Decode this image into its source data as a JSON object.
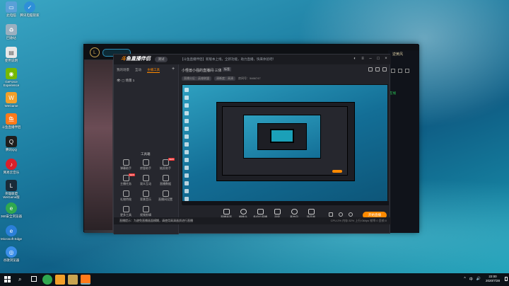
{
  "desktop": {
    "icons": [
      {
        "label": "此电脑",
        "icon": "computer-icon",
        "color": "#5aa0d8"
      },
      {
        "label": "腾讯电脑管家",
        "icon": "tencent-manager-icon",
        "color": "#2e8fd8"
      },
      {
        "label": "回收站",
        "icon": "recycle-bin-icon",
        "color": "#9ab0c0"
      },
      {
        "label": "使用说明",
        "icon": "document-icon",
        "color": "#e8e8e8"
      },
      {
        "label": "GeForce Experience",
        "icon": "geforce-icon",
        "color": "#76b900"
      },
      {
        "label": "WeGame",
        "icon": "wegame-icon",
        "color": "#f2a02a"
      },
      {
        "label": "斗鱼直播伴侣",
        "icon": "douyu-icon",
        "color": "#ff7a1a"
      },
      {
        "label": "腾讯QQ",
        "icon": "qq-icon",
        "color": "#1e1e1e"
      },
      {
        "label": "网易云音乐",
        "icon": "netease-music-icon",
        "color": "#d8202a"
      },
      {
        "label": "英雄联盟WeGame版",
        "icon": "lol-icon",
        "color": "#1a2a38"
      },
      {
        "label": "360安全浏览器",
        "icon": "360-browser-icon",
        "color": "#2fa84f"
      },
      {
        "label": "Microsoft Edge",
        "icon": "edge-icon",
        "color": "#2a7fd8"
      },
      {
        "label": "谷歌浏览器",
        "icon": "chrome-icon",
        "color": "#3a8ee8"
      }
    ]
  },
  "game_client": {
    "right_panel_name": "逆黄风",
    "online_status": "在线"
  },
  "stream_app": {
    "brand_mark": "斗",
    "brand": "鱼直播伴侣",
    "beta_label": "测试",
    "notice": "【斗鱼直播伴侣】新版本上线，全新功能，助力直播，快来体验吧！",
    "tabs": [
      "我的场景",
      "互动",
      "主播工具"
    ],
    "active_tab_index": 2,
    "scene_label": "场景 1",
    "tools_title": "工具箱",
    "tools": [
      {
        "label": "弹幕助手",
        "badge": ""
      },
      {
        "label": "房管助手",
        "badge": ""
      },
      {
        "label": "抽奖助手",
        "badge": "NEW"
      },
      {
        "label": "主播任务",
        "badge": "NEW"
      },
      {
        "label": "观众互动",
        "badge": ""
      },
      {
        "label": "直播数据",
        "badge": ""
      },
      {
        "label": "礼物特效",
        "badge": ""
      },
      {
        "label": "背景音乐",
        "badge": ""
      },
      {
        "label": "直播间设置",
        "badge": ""
      },
      {
        "label": "更多工具",
        "badge": ""
      },
      {
        "label": "视频剪辑",
        "badge": ""
      }
    ],
    "room_title": "小怪兽小强的直播间·三体",
    "room_tag": "标签",
    "room_meta": [
      "直播分区：英雄联盟",
      "清晰度：高清"
    ],
    "room_id": "房间号：5466747",
    "controls": [
      "直播画面",
      "摄像头",
      "多机位直播",
      "录屏",
      "麦克风",
      "扬声器"
    ],
    "start_live_label": "开始直播",
    "status_text": "直播提示：为避免直播画面模糊，请使用高清画质进行直播",
    "stats": "CPU:2%   内存:32%   上行:0kbps   帧率:0   丢帧:0"
  },
  "taskbar": {
    "time": "22:00",
    "date": "2020/7/28",
    "tray": [
      "^",
      "中",
      "🔊"
    ],
    "apps": [
      {
        "icon": "360-app-icon",
        "color": "#2fa84f"
      },
      {
        "icon": "wegame-app-icon",
        "color": "#f2a02a"
      },
      {
        "icon": "lol-app-icon",
        "color": "#c9a450"
      },
      {
        "icon": "douyu-app-icon",
        "color": "#ff7a1a"
      }
    ]
  }
}
